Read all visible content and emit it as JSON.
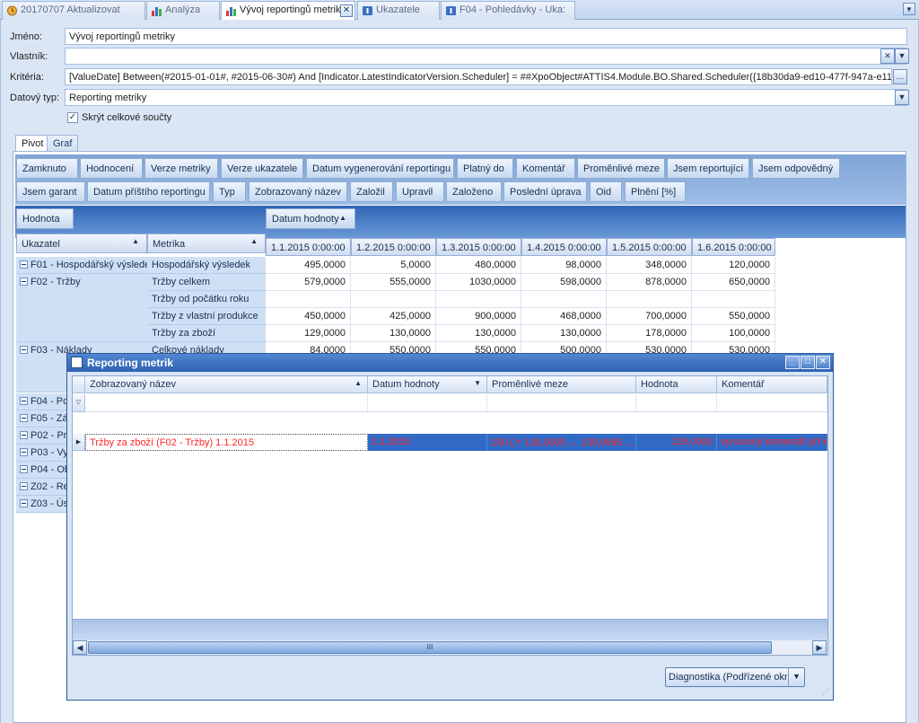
{
  "tabs": [
    {
      "label": "20170707 Aktualizovat",
      "icon": "clock-icon"
    },
    {
      "label": "Analýza",
      "icon": "chart-icon"
    },
    {
      "label": "Vývoj reportingů metrik",
      "icon": "chart-icon",
      "active": true
    },
    {
      "label": "Ukazatele",
      "icon": "info-icon"
    },
    {
      "label": "F04 - Pohledávky - Uka:",
      "icon": "info-icon"
    }
  ],
  "form": {
    "name_label": "Jméno:",
    "name_value": "Vývoj reportingů metriky",
    "owner_label": "Vlastník:",
    "owner_value": "",
    "criteria_label": "Kritéria:",
    "criteria_value": "[ValueDate] Between(#2015-01-01#, #2015-06-30#) And [Indicator.LatestIndicatorVersion.Scheduler] = ##XpoObject#ATTIS4.Module.BO.Shared.Scheduler({18b30da9-ed10-477f-947a-e1147d7…",
    "datatype_label": "Datový typ:",
    "datatype_value": "Reporting metriky",
    "hide_totals_label": "Skrýt celkové součty",
    "hide_totals_checked": true
  },
  "pivot_tabs": [
    "Pivot",
    "Graf"
  ],
  "filter_fields_row1": [
    "Zamknuto",
    "Hodnocení",
    "Verze metriky",
    "Verze ukazatele",
    "Datum vygenerování reportingu",
    "Platný do",
    "Komentář",
    "Proměnlivé meze",
    "Jsem reportující",
    "Jsem odpovědný"
  ],
  "filter_fields_row2": [
    "Jsem garant",
    "Datum příštího reportingu",
    "Typ",
    "Zobrazovaný název",
    "Založil",
    "Upravil",
    "Založeno",
    "Poslední úprava",
    "Oid",
    "Plnění [%]"
  ],
  "data_field": "Hodnota",
  "column_field": "Datum hodnoty",
  "row_field_1": "Ukazatel",
  "row_field_2": "Metrika",
  "columns": [
    "1.1.2015 0:00:00",
    "1.2.2015 0:00:00",
    "1.3.2015 0:00:00",
    "1.4.2015 0:00:00",
    "1.5.2015 0:00:00",
    "1.6.2015 0:00:00"
  ],
  "indicators": [
    "F01 - Hospodářský výsledek",
    "F02 - Tržby",
    "F03 - Náklady",
    "F04 - Po",
    "F05 - Zá",
    "P02 - Pro",
    "P03 - Vy",
    "P04 - Ob",
    "Z02 - Re",
    "Z03 - Ús"
  ],
  "rows": [
    {
      "metric": "Hospodářský výsledek",
      "values": [
        "495,0000",
        "5,0000",
        "480,0000",
        "98,0000",
        "348,0000",
        "120,0000"
      ]
    },
    {
      "metric": "Tržby celkem",
      "values": [
        "579,0000",
        "555,0000",
        "1030,0000",
        "598,0000",
        "878,0000",
        "650,0000"
      ]
    },
    {
      "metric": "Tržby od počátku roku",
      "values": [
        "",
        "",
        "",
        "",
        "",
        ""
      ]
    },
    {
      "metric": "Tržby z vlastní produkce",
      "values": [
        "450,0000",
        "425,0000",
        "900,0000",
        "468,0000",
        "700,0000",
        "550,0000"
      ]
    },
    {
      "metric": "Tržby za zboží",
      "values": [
        "129,0000",
        "130,0000",
        "130,0000",
        "130,0000",
        "178,0000",
        "100,0000"
      ]
    },
    {
      "metric": "Celkové náklady",
      "values": [
        "84,0000",
        "550,0000",
        "550,0000",
        "500,0000",
        "530,0000",
        "530,0000"
      ]
    }
  ],
  "dialog": {
    "title": "Reporting metrik",
    "columns": [
      "Zobrazovaný název",
      "Datum hodnoty",
      "Proměnlivé meze",
      "Hodnota",
      "Komentář"
    ],
    "row": [
      "Tržby za zboží (F02 - Tržby) 1.1.2015",
      "1.1.2015",
      "150 (↗ 130,0005 → 139,9995 …",
      "129,0000",
      "vynucený komentář při kri"
    ],
    "action_button": "Diagnostika (Podřízené okno)",
    "scroll_grip": "III"
  }
}
